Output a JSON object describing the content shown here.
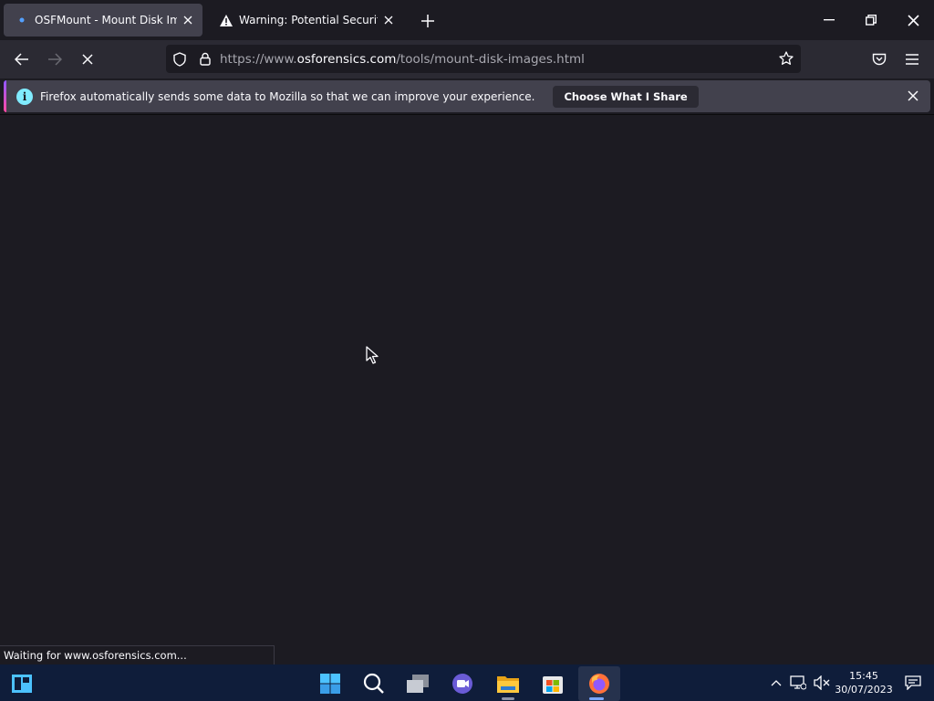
{
  "tabs": [
    {
      "title": "OSFMount - Mount Disk Images",
      "active": true
    },
    {
      "title": "Warning: Potential Security Risk Ahead",
      "active": false
    }
  ],
  "url": {
    "prefix": "https://www.",
    "domain": "osforensics.com",
    "path": "/tools/mount-disk-images.html"
  },
  "notification": {
    "text": "Firefox automatically sends some data to Mozilla so that we can improve your experience.",
    "button_label": "Choose What I Share"
  },
  "status_text": "Waiting for www.osforensics.com...",
  "clock": {
    "time": "15:45",
    "date": "30/07/2023"
  },
  "colors": {
    "accent": "#80ebff",
    "taskbar": "#0f1d3a",
    "background": "#1c1b22"
  },
  "icons": [
    "window-minimize-icon",
    "window-restore-icon",
    "window-close-icon",
    "back-icon",
    "forward-icon",
    "stop-icon",
    "shield-icon",
    "lock-icon",
    "star-icon",
    "pocket-icon",
    "menu-icon",
    "info-icon",
    "windows-start-icon",
    "search-icon",
    "task-view-icon",
    "chat-icon",
    "file-explorer-icon",
    "store-icon",
    "firefox-icon",
    "chevron-up-icon",
    "network-icon",
    "volume-muted-icon",
    "notification-icon"
  ]
}
